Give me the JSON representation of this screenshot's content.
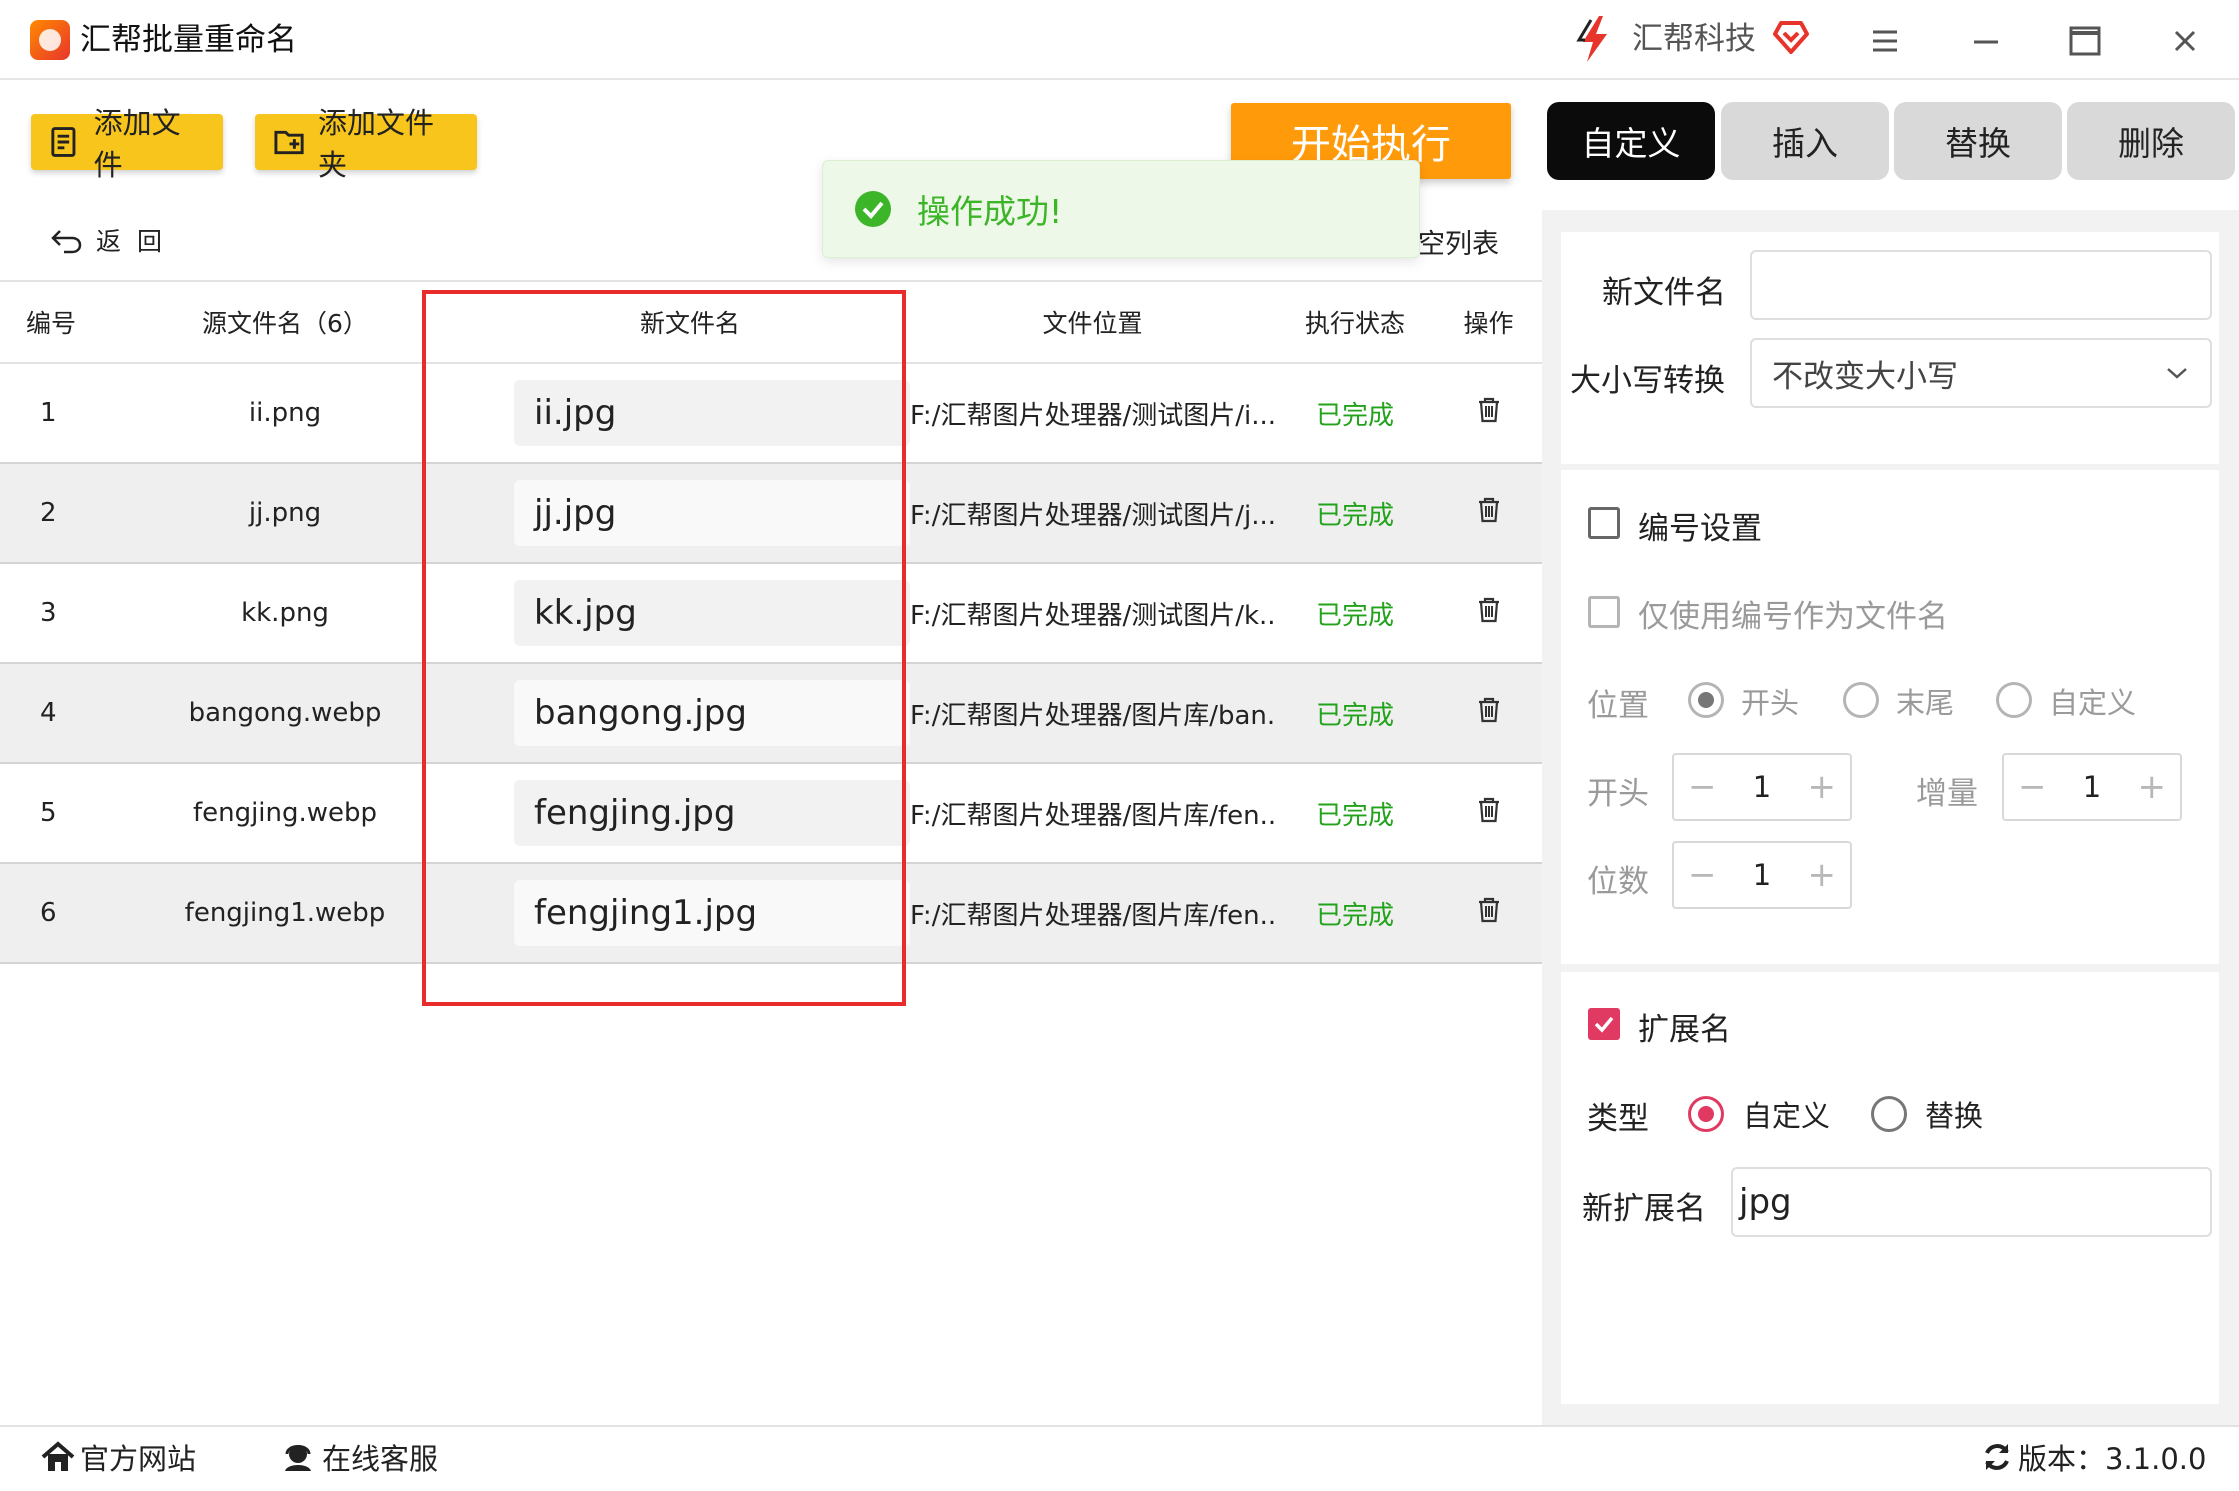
{
  "app": {
    "title": "汇帮批量重命名",
    "brand": "汇帮科技"
  },
  "toolbar": {
    "add_file": "添加文件",
    "add_folder": "添加文件夹",
    "start": "开始执行",
    "back": "返  回",
    "clear_list": "空列表"
  },
  "toast": {
    "text": "操作成功!"
  },
  "table": {
    "headers": [
      "编号",
      "源文件名（6）",
      "新文件名",
      "文件位置",
      "执行状态",
      "操作"
    ],
    "rows": [
      {
        "num": "1",
        "src": "ii.png",
        "new": "ii.jpg",
        "loc": "F:/汇帮图片处理器/测试图片/i...",
        "status": "已完成"
      },
      {
        "num": "2",
        "src": "jj.png",
        "new": "jj.jpg",
        "loc": "F:/汇帮图片处理器/测试图片/j...",
        "status": "已完成"
      },
      {
        "num": "3",
        "src": "kk.png",
        "new": "kk.jpg",
        "loc": "F:/汇帮图片处理器/测试图片/k...",
        "status": "已完成"
      },
      {
        "num": "4",
        "src": "bangong.webp",
        "new": "bangong.jpg",
        "loc": "F:/汇帮图片处理器/图片库/ban...",
        "status": "已完成"
      },
      {
        "num": "5",
        "src": "fengjing.webp",
        "new": "fengjing.jpg",
        "loc": "F:/汇帮图片处理器/图片库/fen...",
        "status": "已完成"
      },
      {
        "num": "6",
        "src": "fengjing1.webp",
        "new": "fengjing1.jpg",
        "loc": "F:/汇帮图片处理器/图片库/fen...",
        "status": "已完成"
      }
    ]
  },
  "tabs": [
    "自定义",
    "插入",
    "替换",
    "删除"
  ],
  "panel": {
    "new_name_label": "新文件名",
    "new_name_value": "",
    "case_label": "大小写转换",
    "case_value": "不改变大小写",
    "numbering_label": "编号设置",
    "only_number_label": "仅使用编号作为文件名",
    "position_label": "位置",
    "position_options": [
      "开头",
      "末尾",
      "自定义"
    ],
    "start_label": "开头",
    "start_value": "1",
    "increment_label": "增量",
    "increment_value": "1",
    "digits_label": "位数",
    "digits_value": "1",
    "ext_label": "扩展名",
    "type_label": "类型",
    "type_options": [
      "自定义",
      "替换"
    ],
    "new_ext_label": "新扩展名",
    "new_ext_value": "jpg"
  },
  "statusbar": {
    "website": "官方网站",
    "support": "在线客服",
    "version": "版本：3.1.0.0"
  },
  "colors": {
    "accent_yellow": "#f7c51c",
    "start_orange": "#ff9a0a",
    "success_green": "#22a31b",
    "highlight_red": "#e82c2c",
    "check_pink": "#e03a62"
  }
}
